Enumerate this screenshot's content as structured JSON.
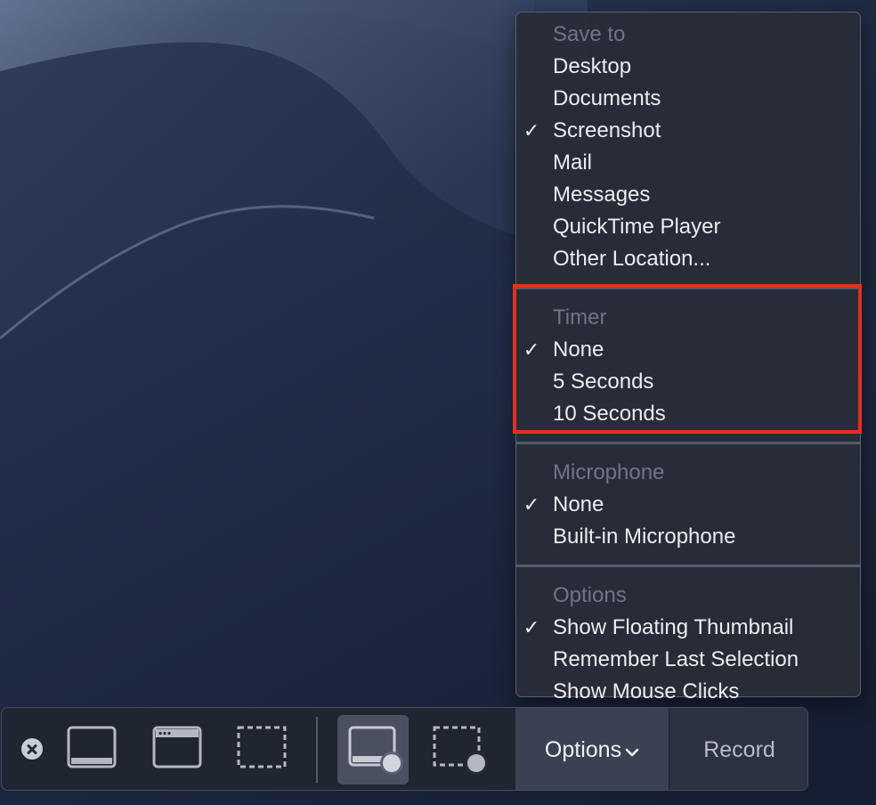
{
  "menu": {
    "sections": [
      {
        "header": "Save to",
        "items": [
          {
            "label": "Desktop",
            "checked": false
          },
          {
            "label": "Documents",
            "checked": false
          },
          {
            "label": "Screenshot",
            "checked": true
          },
          {
            "label": "Mail",
            "checked": false
          },
          {
            "label": "Messages",
            "checked": false
          },
          {
            "label": "QuickTime Player",
            "checked": false
          },
          {
            "label": "Other Location...",
            "checked": false
          }
        ]
      },
      {
        "header": "Timer",
        "items": [
          {
            "label": "None",
            "checked": true
          },
          {
            "label": "5 Seconds",
            "checked": false
          },
          {
            "label": "10 Seconds",
            "checked": false
          }
        ]
      },
      {
        "header": "Microphone",
        "items": [
          {
            "label": "None",
            "checked": true
          },
          {
            "label": "Built-in Microphone",
            "checked": false
          }
        ]
      },
      {
        "header": "Options",
        "items": [
          {
            "label": "Show Floating Thumbnail",
            "checked": true
          },
          {
            "label": "Remember Last Selection",
            "checked": false
          },
          {
            "label": "Show Mouse Clicks",
            "checked": false
          }
        ]
      }
    ],
    "check_glyph": "✓",
    "highlight_color": "#e3301f"
  },
  "toolbar": {
    "options_label": "Options",
    "record_label": "Record",
    "buttons": [
      {
        "icon": "capture-entire-screen-icon",
        "active": false
      },
      {
        "icon": "capture-window-icon",
        "active": false
      },
      {
        "icon": "capture-selection-icon",
        "active": false
      },
      {
        "icon": "record-entire-screen-icon",
        "active": true
      },
      {
        "icon": "record-selection-icon",
        "active": false
      }
    ]
  }
}
